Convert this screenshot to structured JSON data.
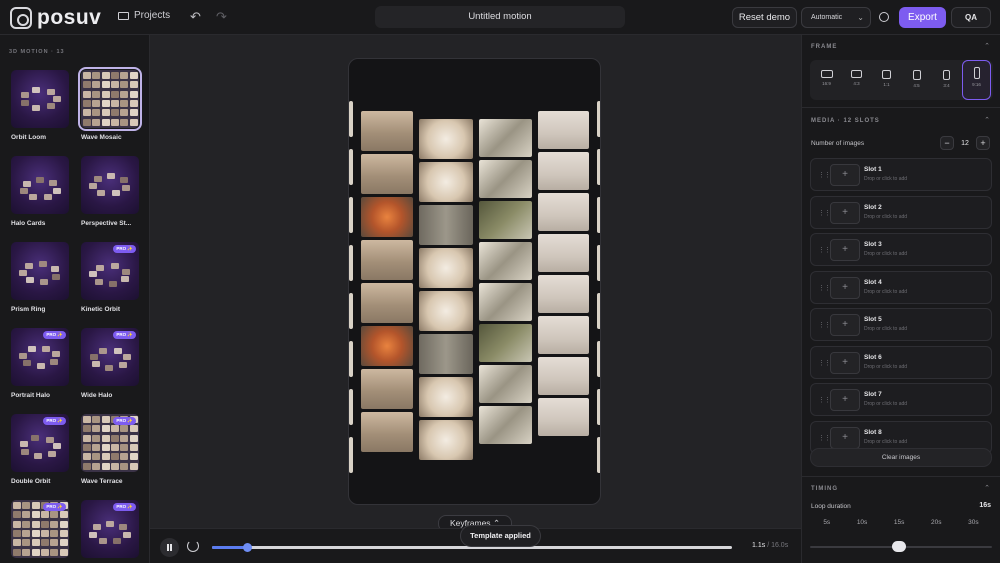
{
  "app": {
    "logo_text": "posuv",
    "projects_label": "Projects",
    "title": "Untitled motion",
    "reset_label": "Reset demo",
    "mode_select": "Automatic",
    "export_label": "Export",
    "qa_label": "QA"
  },
  "sidebar": {
    "header": "3D MOTION · 13",
    "templates": [
      {
        "label": "Orbit Loom",
        "pro": false
      },
      {
        "label": "Wave Mosaic",
        "pro": false,
        "selected": true
      },
      {
        "label": "Halo Cards",
        "pro": false
      },
      {
        "label": "Perspective St...",
        "pro": false
      },
      {
        "label": "Prism Ring",
        "pro": false
      },
      {
        "label": "Kinetic Orbit",
        "pro": true
      },
      {
        "label": "Portrait Halo",
        "pro": true
      },
      {
        "label": "Wide Halo",
        "pro": true
      },
      {
        "label": "Double Orbit",
        "pro": true
      },
      {
        "label": "Wave Terrace",
        "pro": true
      },
      {
        "label": "",
        "pro": true
      },
      {
        "label": "",
        "pro": true
      }
    ],
    "pro_badge": "PRO ✨"
  },
  "canvas": {
    "keyframes_label": "Keyframes",
    "toast": "Template applied"
  },
  "timeline": {
    "progress": 0.069,
    "current_time": "1.1s",
    "total_time": "/ 16.0s"
  },
  "panel": {
    "frame_title": "FRAME",
    "frames": [
      {
        "label": "16:9",
        "active": false
      },
      {
        "label": "4:3",
        "active": false
      },
      {
        "label": "1:1",
        "active": false
      },
      {
        "label": "4:5",
        "active": false
      },
      {
        "label": "3:4",
        "active": false
      },
      {
        "label": "9:16",
        "active": true
      }
    ],
    "media_title": "MEDIA · 12 SLOTS",
    "num_images_label": "Number of images",
    "num_images": "12",
    "stepper_minus": "−",
    "stepper_plus": "+",
    "slot_hint": "Drop or click to add",
    "slots": [
      "Slot 1",
      "Slot 2",
      "Slot 3",
      "Slot 4",
      "Slot 5",
      "Slot 6",
      "Slot 7",
      "Slot 8"
    ],
    "clear_label": "Clear images",
    "timing_title": "TIMING",
    "loop_label": "Loop duration",
    "loop_value": "16s",
    "duration_options": [
      "5s",
      "10s",
      "15s",
      "20s",
      "30s"
    ],
    "loop_level": 0.49
  }
}
